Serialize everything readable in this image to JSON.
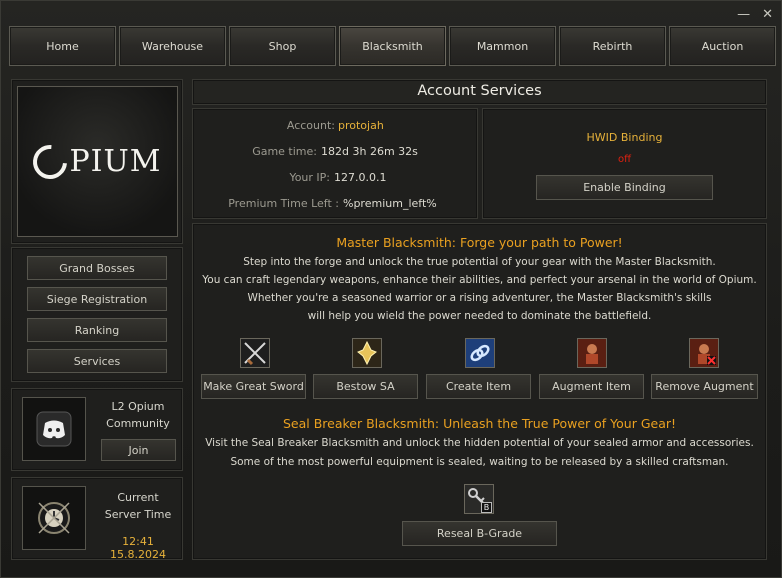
{
  "window": {
    "minimize_glyph": "—",
    "close_glyph": "✕"
  },
  "nav": [
    "Home",
    "Warehouse",
    "Shop",
    "Blacksmith",
    "Mammon",
    "Rebirth",
    "Auction"
  ],
  "nav_active": "Blacksmith",
  "logo": {
    "text": "PIUM"
  },
  "sidebar": {
    "items": [
      "Grand Bosses",
      "Siege Registration",
      "Ranking",
      "Services"
    ]
  },
  "community": {
    "title": "L2 Opium",
    "subtitle": "Community",
    "join_label": "Join",
    "icon": "discord-icon"
  },
  "server_time": {
    "title": "Current",
    "subtitle": "Server Time",
    "value": "12:41 15.8.2024",
    "icon": "clock-icon"
  },
  "account": {
    "header": "Account Services",
    "account_label": "Account:",
    "account_value": "protojah",
    "gametime_label": "Game time:",
    "gametime_value": "182d 3h 26m 32s",
    "ip_label": "Your IP:",
    "ip_value": "127.0.0.1",
    "premium_label": "Premium Time Left :",
    "premium_value": "%premium_left%"
  },
  "hwid": {
    "title": "HWID Binding",
    "status": "off",
    "button": "Enable Binding"
  },
  "master": {
    "title": "Master Blacksmith: Forge your path to Power!",
    "lines": [
      "Step into the forge and unlock the true potential of your gear with the Master Blacksmith.",
      "You can craft legendary weapons, enhance their abilities, and perfect your arsenal in the world of Opium.",
      "Whether you're a seasoned warrior or a rising adventurer, the Master Blacksmith's skills",
      "will help you wield the power needed to dominate the battlefield."
    ],
    "actions": [
      {
        "label": "Make Great Sword",
        "icon": "crossed-swords-icon"
      },
      {
        "label": "Bestow SA",
        "icon": "crystal-icon"
      },
      {
        "label": "Create Item",
        "icon": "chain-link-icon"
      },
      {
        "label": "Augment Item",
        "icon": "augment-icon"
      },
      {
        "label": "Remove Augment",
        "icon": "remove-augment-icon"
      }
    ]
  },
  "seal": {
    "title": "Seal Breaker Blacksmith: Unleash the True Power of Your Gear!",
    "lines": [
      "Visit the Seal Breaker Blacksmith and unlock the hidden potential of your sealed armor and accessories.",
      "Some of the most powerful equipment is sealed, waiting to be released by a skilled craftsman."
    ],
    "action": {
      "label": "Reseal B-Grade",
      "icon": "key-icon",
      "badge": "B"
    }
  }
}
